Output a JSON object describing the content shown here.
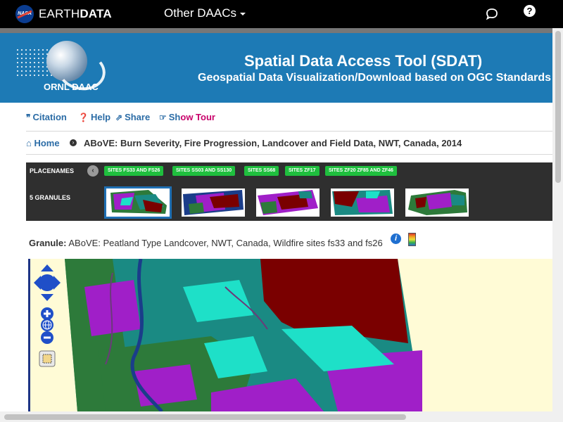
{
  "topbar": {
    "brand_prefix": "EARTH",
    "brand_bold": "DATA",
    "nasa_logo_text": "NASA",
    "other_daacs": "Other DAACs",
    "help_glyph": "?"
  },
  "banner": {
    "logo_text": "ORNL DAAC",
    "title": "Spatial Data Access Tool (SDAT)",
    "subtitle": "Geospatial Data Visualization/Download based on OGC Standards"
  },
  "toolbar": {
    "citation": "Citation",
    "help": "Help",
    "share": "Share",
    "show_tour_a": "Sh",
    "show_tour_b": "ow Tour"
  },
  "breadcrumb": {
    "home": "Home",
    "dataset": "ABoVE: Burn Severity, Fire Progression, Landcover and Field Data, NWT, Canada, 2014"
  },
  "panel": {
    "placenames_label": "PLACENAMES",
    "granules_label": "5 GRANULES",
    "sites": [
      "SITES FS33 AND FS26",
      "SITES SS03 AND SS130",
      "SITES SS68",
      "SITES ZF17",
      "SITES ZF20 ZF85 AND ZF46"
    ]
  },
  "granule": {
    "label": "Granule:",
    "name": "ABoVE: Peatland Type Landcover, NWT, Canada, Wildfire sites fs33 and fs26",
    "info_glyph": "i"
  },
  "colors": {
    "banner": "#1d7ab5",
    "link": "#2b6ca6",
    "site_button": "#1fbf3e",
    "map_background": "#fffbd6",
    "map_dark_red": "#7a0000",
    "map_teal": "#1a8a83",
    "map_cyan": "#1ee0c8",
    "map_purple": "#a01fc8",
    "map_green": "#2d7a3a"
  },
  "icons": [
    "nasa-logo",
    "chat-icon",
    "help-icon",
    "quote-icon",
    "question-circle-icon",
    "share-icon",
    "hand-pointer-icon",
    "home-icon",
    "chevron-right-icon",
    "chevron-left-icon",
    "info-icon",
    "legend-icon",
    "pan-arrows-icon",
    "zoom-in-icon",
    "globe-icon",
    "zoom-out-icon",
    "zoom-extent-icon"
  ]
}
